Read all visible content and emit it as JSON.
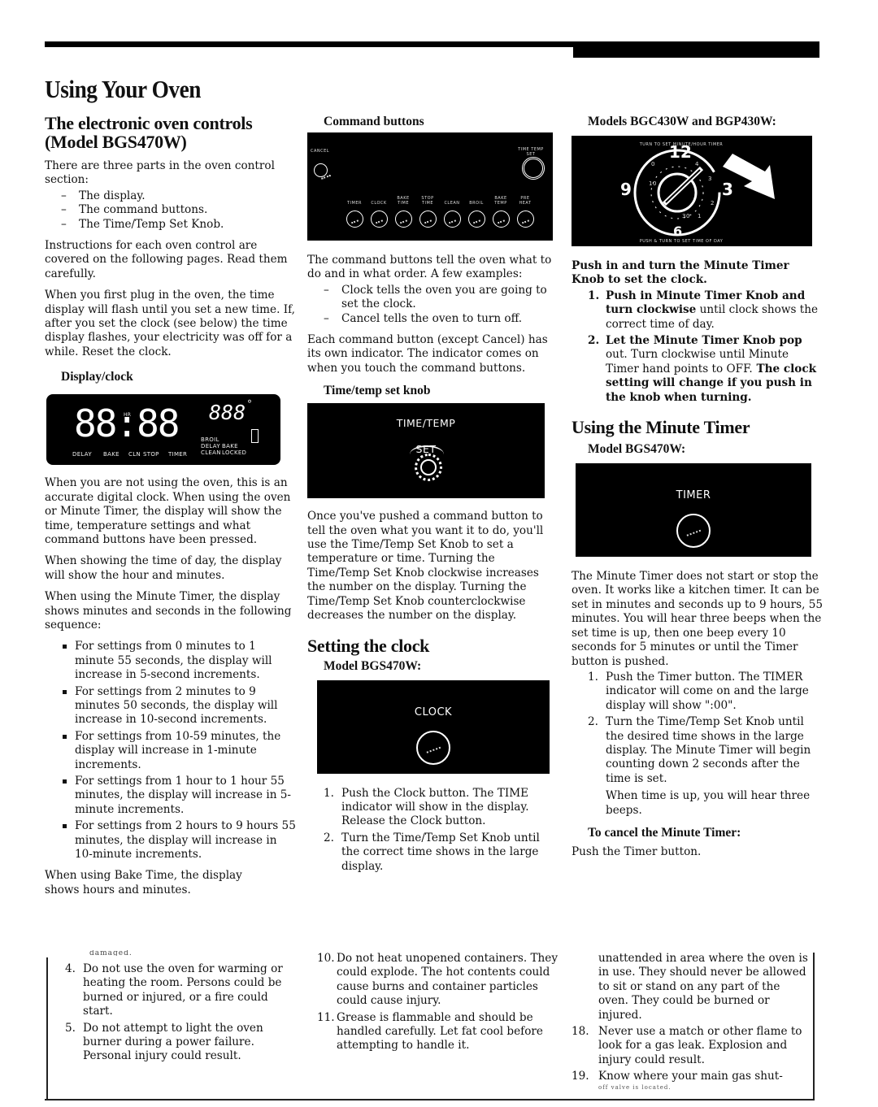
{
  "page": {
    "title": "Using Your Oven"
  },
  "col1": {
    "heading": "The electronic oven controls (Model BGS470W)",
    "intro": "There are three parts in the oven control section:",
    "parts": [
      "The display.",
      "The command buttons.",
      "The Time/Temp Set Knob."
    ],
    "p_instructions": "Instructions for each oven control are covered on the following pages. Read them carefully.",
    "p_first_plug": "When you first plug in the oven, the time display will flash until you set a new time. If, after you set the clock (see below) the time display flashes, your electricity was off for a while. Reset the clock.",
    "display_heading": "Display/clock",
    "display_panel": {
      "digits": "88:88",
      "temp_digits": "888",
      "degree": "°",
      "hr_label": "HR",
      "labels": [
        "DELAY",
        "BAKE",
        "CLN",
        "STOP",
        "TIMER"
      ],
      "right_labels_1": [
        "BROIL",
        "DELAY",
        "CLEAN"
      ],
      "right_labels_2": [
        "BAKE",
        "LOCKED"
      ],
      "lock_icon_text": "O\\"
    },
    "p_not_using": "When you are not using the oven, this is an accurate digital clock. When using the oven or Minute Timer, the display will show the time, temperature settings and what command buttons have been pressed.",
    "p_time_of_day": "When showing the time of day, the display will show the hour and minutes.",
    "p_minute_timer": "When using the Minute Timer, the display shows minutes and seconds in the following sequence:",
    "sequence": [
      "For settings from 0 minutes to 1 minute 55 seconds, the display will increase in 5-second increments.",
      "For settings from 2 minutes to 9 minutes 50 seconds, the display will increase in 10-second increments.",
      "For settings from 10-59 minutes, the display will increase in 1-minute increments.",
      "For settings from 1 hour to 1 hour 55 minutes, the display will increase in 5-minute increments.",
      "For settings from 2 hours to 9 hours 55 minutes, the display will increase in 10-minute increments."
    ],
    "p_bake_time": "When using Bake Time, the display shows hours and minutes.",
    "cut_off_text": "damaged.",
    "safety": [
      {
        "n": "4.",
        "text": "Do not use the oven for warming or heating the room. Persons could be burned or injured, or a fire could start."
      },
      {
        "n": "5.",
        "text": "Do not attempt to light the oven burner during a power failure. Personal injury could result."
      }
    ]
  },
  "col2": {
    "command_heading": "Command buttons",
    "command_panel": {
      "cancel_label": "CANCEL",
      "knob_label": "TIME TEMP SET",
      "buttons": [
        "TIMER",
        "CLOCK",
        "BAKE TIME",
        "STOP TIME",
        "CLEAN",
        "BROIL",
        "BAKE TEMP",
        "PRE HEAT"
      ]
    },
    "p_command": "The command buttons tell the oven what to do and in what order. A few examples:",
    "examples": [
      "Clock tells the oven you are going to set the clock.",
      "Cancel tells the oven to turn off."
    ],
    "p_indicator": "Each command button (except Cancel) has its own indicator. The indicator comes on when you touch the command buttons.",
    "knob_heading": "Time/temp set knob",
    "knob_panel": {
      "line1": "TIME/TEMP",
      "line2": "SET"
    },
    "p_knob": "Once you've pushed a command button to tell the oven what you want it to do, you'll use the Time/Temp Set Knob to set a temperature or time. Turning the Time/Temp Set Knob clockwise increases the number on the display. Turning the Time/Temp Set Knob counterclockwise decreases the number on the display.",
    "clock_heading": "Setting the clock",
    "clock_model": "Model BGS470W:",
    "clock_panel_label": "CLOCK",
    "clock_steps": [
      {
        "n": "1.",
        "text": "Push the Clock button. The TIME indicator will show in the display. Release the Clock button."
      },
      {
        "n": "2.",
        "text": "Turn the Time/Temp Set Knob until the correct time shows in the large display."
      }
    ],
    "safety": [
      {
        "n": "10.",
        "text": "Do not heat unopened containers. They could explode. The hot contents could cause burns and container particles could cause injury."
      },
      {
        "n": "11.",
        "text": "Grease is flammable and should be handled carefully. Let fat cool before attempting to handle it."
      }
    ]
  },
  "col3": {
    "models_heading": "Models BGC430W and BGP430W:",
    "dial_panel": {
      "top_text": "TURN TO SET MINUTE/HOUR TIMER",
      "bottom_text": "PUSH & TURN TO SET TIME OF DAY",
      "hours": [
        "12",
        "3",
        "6",
        "9"
      ],
      "minutes": [
        "0",
        "4",
        "3",
        "2",
        "1",
        "30",
        "10"
      ]
    },
    "push_turn_bold": "Push in and turn the Minute Timer Knob to set the clock.",
    "dial_steps": [
      {
        "n": "1.",
        "bold": "Push in Minute Timer Knob and turn clockwise",
        "rest": " until clock shows the correct time of day."
      },
      {
        "n": "2.",
        "bold": "Let the Minute Timer Knob pop",
        "rest": " out. Turn clockwise until Minute Timer hand points to OFF.",
        "bold2": " The clock setting will change if you push in the knob when turning."
      }
    ],
    "timer_heading": "Using the Minute Timer",
    "timer_model": "Model BGS470W:",
    "timer_panel_label": "TIMER",
    "p_timer": "The Minute Timer does not start or stop the oven. It works like a kitchen timer. It can be set in minutes and seconds up to 9 hours, 55 minutes. You will hear three beeps when the set time is up, then one beep every 10 seconds for 5 minutes or until the Timer button is pushed.",
    "timer_steps": [
      {
        "n": "1.",
        "text": "Push the Timer button. The TIMER indicator will come on and the large display will show \":00\"."
      },
      {
        "n": "2.",
        "text": "Turn the Time/Temp Set Knob until the desired time shows in the large display. The Minute Timer will begin counting down 2 seconds after the time is set."
      }
    ],
    "p_time_up": "When time is up, you will hear three beeps.",
    "cancel_heading": "To cancel the Minute Timer:",
    "p_cancel": "Push the Timer button.",
    "safety_cont": "unattended in area where the oven is in use. They should never be allowed to sit or stand on any part of the oven. They could be burned or injured.",
    "safety": [
      {
        "n": "18.",
        "text": "Never use a match or other flame to look for a gas leak. Explosion and injury could result."
      },
      {
        "n": "19.",
        "text": "Know where your main gas shut-"
      }
    ],
    "cut_off_bottom": "off valve is located."
  }
}
